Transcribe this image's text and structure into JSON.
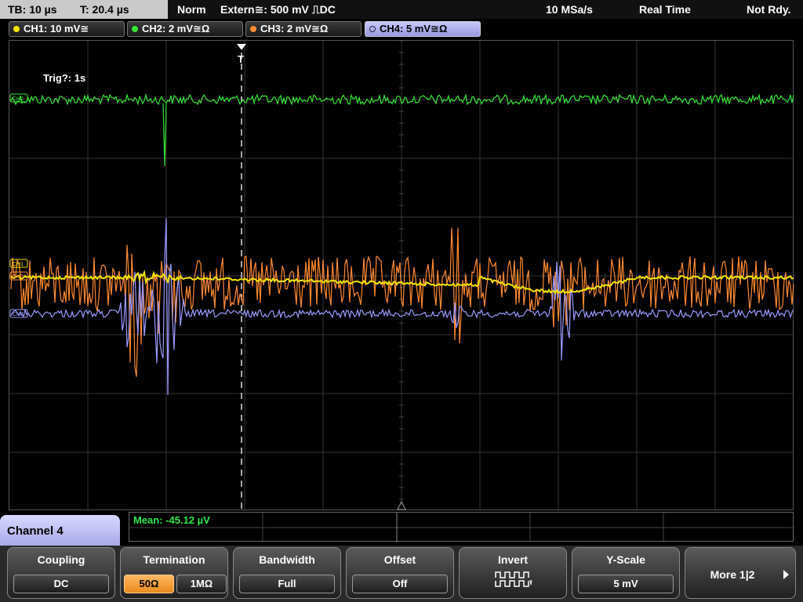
{
  "status": {
    "timebase": "TB: 10 µs",
    "trigger_time": "T: 20.4 µs",
    "mode": "Norm",
    "trigger_source": "Extern≅: 500 mV ⎍DC",
    "sample_rate": "10 MSa/s",
    "acq_mode": "Real Time",
    "state": "Not Rdy."
  },
  "channels": [
    {
      "label": "CH1: 10 mV≅",
      "color": "#f5e400"
    },
    {
      "label": "CH2: 2 mV≅Ω",
      "color": "#36e536"
    },
    {
      "label": "CH3: 2 mV≅Ω",
      "color": "#ff8a30"
    },
    {
      "label": "CH4: 5 mV≅Ω",
      "color": "#9a9aff"
    }
  ],
  "screen": {
    "trig_info": "Trig?: 1s",
    "trigger_marker": "T",
    "ch_markers": [
      "CH2",
      "CH1",
      "CH3",
      "CH4"
    ]
  },
  "measurement": {
    "text": "Mean: -45.12 µV"
  },
  "menu": {
    "title": "Channel 4",
    "softkeys": [
      {
        "label": "Coupling",
        "value": "DC"
      },
      {
        "label": "Termination",
        "options": [
          "50Ω",
          "1MΩ"
        ],
        "selected": "50Ω"
      },
      {
        "label": "Bandwidth",
        "value": "Full"
      },
      {
        "label": "Offset",
        "value": "Off"
      },
      {
        "label": "Invert",
        "icon": "inverted-square-wave-icon"
      },
      {
        "label": "Y-Scale",
        "value": "5 mV"
      }
    ],
    "more": "More 1|2"
  },
  "colors": {
    "ch1": "#f5e400",
    "ch2": "#36e536",
    "ch3": "#ff8a30",
    "ch4": "#9a9aff",
    "menu_accent": "#b8b8f0",
    "selected_option": "#f0a040"
  }
}
